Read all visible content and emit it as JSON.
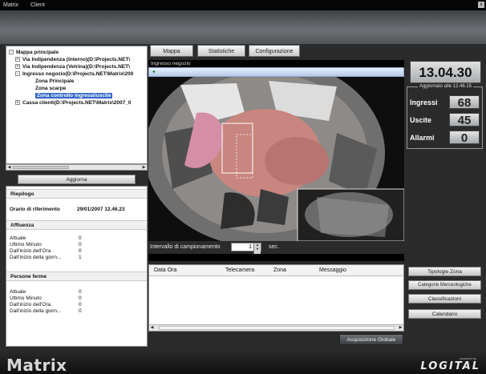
{
  "titlebar": {
    "app": "Matrix",
    "client": "Client",
    "close": "x"
  },
  "tree": {
    "rows": [
      {
        "expander": "-",
        "label": "Mappa principale",
        "selected": false
      },
      {
        "expander": "+",
        "label": "Via Indipendenza (Interno)(D:\\Projects.NET\\",
        "selected": false
      },
      {
        "expander": "+",
        "label": "Via Indipendenza (Vetrina)(D:\\Projects.NET\\",
        "selected": false
      },
      {
        "expander": "-",
        "label": "Ingresso negozio(D:\\Projects.NET\\Matrix\\200",
        "selected": false
      },
      {
        "expander": "",
        "label": "Zona Principale",
        "selected": false
      },
      {
        "expander": "",
        "label": "Zona scarpe",
        "selected": false
      },
      {
        "expander": "",
        "label": "Zona controllo ingressi/uscite",
        "selected": true
      },
      {
        "expander": "+",
        "label": "Cassa clienti(D:\\Projects.NET\\Matrix\\2007_0",
        "selected": false
      }
    ]
  },
  "buttons": {
    "update": "Aggiorna",
    "global_acquisition": "Acquisizione Globale",
    "zone_types": "Tipologie Zona",
    "product_categories": "Categorie Merceologiche",
    "rankings": "Classificazioni",
    "calendar": "Calendario"
  },
  "summary": {
    "title": "Riepilogo",
    "reference_label": "Orario di riferimento",
    "reference_value": "29/01/2007 12.46.23",
    "affluence": {
      "title": "Affluenza",
      "rows": [
        {
          "label": "Attuale",
          "value": "0"
        },
        {
          "label": "Ultimo Minuto",
          "value": "0"
        },
        {
          "label": "Dall'inizio dell'Ora",
          "value": "0"
        },
        {
          "label": "Dall'inizio della giorn...",
          "value": "1"
        }
      ]
    },
    "stopped": {
      "title": "Persone ferme",
      "rows": [
        {
          "label": "Attuale",
          "value": "0"
        },
        {
          "label": "Ultimo Minuto",
          "value": "0"
        },
        {
          "label": "Dall'inizio dell'Ora",
          "value": "0"
        },
        {
          "label": "Dall'inizio della giorn...",
          "value": "0"
        }
      ]
    }
  },
  "tabs": [
    "Mappa",
    "Statistiche",
    "Configurazione"
  ],
  "camera": {
    "title": "Ingresso negozio"
  },
  "sampling": {
    "label": "Intervallo di campionamento",
    "value": "1",
    "unit": "sec."
  },
  "messages": {
    "columns": [
      "Data Ora",
      "Telecamera",
      "Zona",
      "Messaggio"
    ],
    "rows": []
  },
  "clock": "13.04.30",
  "counters": {
    "updated": "Aggiornato alle 12.46.15",
    "entries_label": "Ingressi",
    "entries": "68",
    "exits_label": "Uscite",
    "exits": "45",
    "alarms_label": "Allarmi",
    "alarms": "0"
  },
  "footer": {
    "logo": "Matrix",
    "powered_by": "powered by",
    "brand": "LOGITAL"
  },
  "colors": {
    "selection": "#3166c8",
    "background": "#2b2b2b",
    "floor_pink": "#c9857f"
  }
}
